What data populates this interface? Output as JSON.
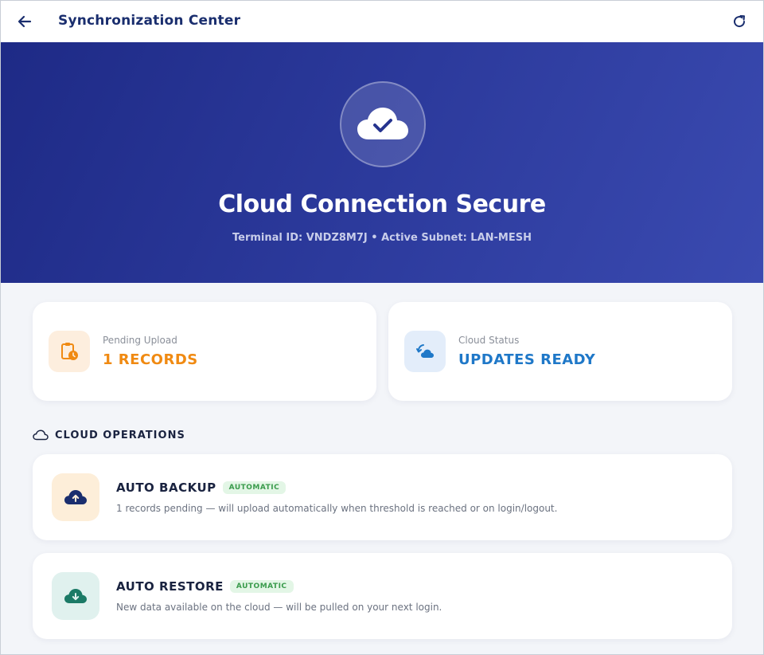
{
  "header": {
    "title": "Synchronization Center",
    "back_icon": "arrow-left-icon",
    "refresh_icon": "refresh-icon"
  },
  "hero": {
    "icon": "cloud-check-icon",
    "title": "Cloud Connection Secure",
    "subtitle": "Terminal ID: VNDZ8M7J • Active Subnet: LAN-MESH"
  },
  "stats": [
    {
      "label": "Pending Upload",
      "value": "1 RECORDS",
      "icon": "clipboard-clock-icon",
      "color": "#f08a12"
    },
    {
      "label": "Cloud Status",
      "value": "UPDATES READY",
      "icon": "cloud-sync-icon",
      "color": "#1f78c8"
    }
  ],
  "section": {
    "label": "CLOUD OPERATIONS",
    "icon": "cloud-outline-icon"
  },
  "operations": [
    {
      "title": "AUTO BACKUP",
      "badge": "AUTOMATIC",
      "description": "1 records pending — will upload automatically when threshold is reached or on login/logout.",
      "icon": "cloud-upload-icon"
    },
    {
      "title": "AUTO RESTORE",
      "badge": "AUTOMATIC",
      "description": "New data available on the cloud — will be pulled on your next login.",
      "icon": "cloud-download-icon"
    }
  ],
  "colors": {
    "hero_start": "#1e2a86",
    "hero_end": "#3a4ab0",
    "title_navy": "#1a2e6e",
    "accent_orange": "#f08a12",
    "accent_blue": "#1f78c8",
    "badge_green": "#3a9b4c"
  }
}
